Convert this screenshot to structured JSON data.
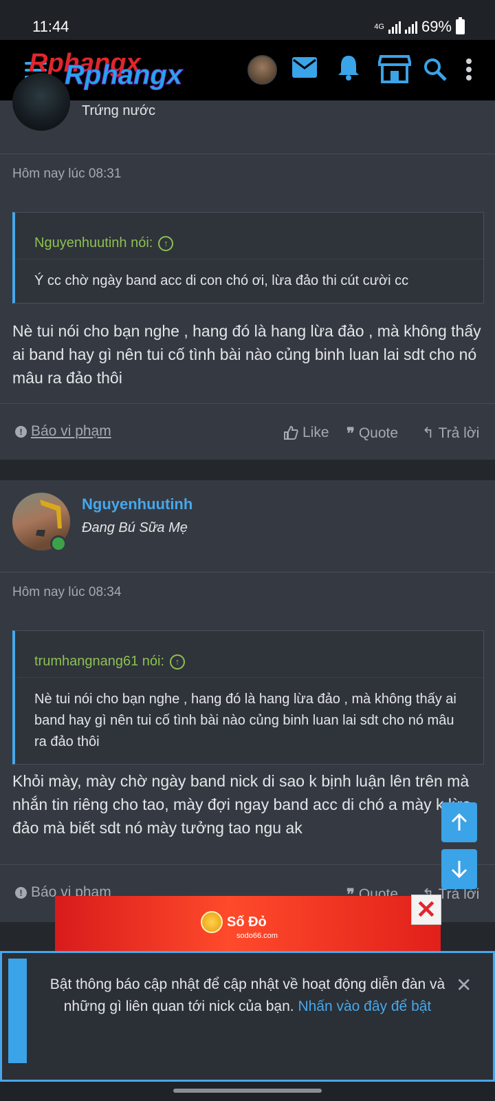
{
  "status": {
    "time": "11:44",
    "network": "4G",
    "battery": "69%"
  },
  "header": {
    "logo_text": "Rphangx"
  },
  "post1": {
    "user_title": "Trứng nước",
    "date": "Hôm nay lúc 08:31",
    "quote_author": "Nguyenhuutinh nói:",
    "quote_text": "Ý cc chờ ngày band acc di con chó ơi, lừa đảo thi cút cười cc",
    "text": "Nè tui nói cho bạn nghe , hang đó là hang lừa đảo , mà không thấy ai band hay gì nên tui cố tình bài nào củng binh luan lai sdt cho nó mâu ra đảo thôi",
    "report": "Báo vi phạm",
    "like": "Like",
    "quote": "Quote",
    "reply": "Trả lời"
  },
  "post2": {
    "username": "Nguyenhuutinh",
    "user_title": "Đang Bú Sữa Mẹ",
    "date": "Hôm nay lúc 08:34",
    "quote_author": "trumhangnang61 nói:",
    "quote_text": "Nè tui nói cho bạn nghe , hang đó là hang lừa đảo , mà không thấy ai band hay gì nên tui cố tình bài nào củng binh luan lai sdt cho nó mâu ra đảo thôi",
    "text": "Khỏi mày, mày chờ ngày band nick di sao k bịnh luận lên trên mà nhắn tin riêng cho tao, mày đợi ngay band acc di chó a mày k lừa đảo mà biết sdt nó mày tưởng tao ngu ak",
    "report": "Báo vi phạm",
    "quote": "Quote",
    "reply": "Trả lời"
  },
  "ad": {
    "brand": "Số Đỏ",
    "site": "sodo66.com"
  },
  "notice": {
    "text": "Bật thông báo cập nhật để cập nhật về hoạt động diễn đàn và những gì liên quan tới nick của bạn. ",
    "link": "Nhấn vào đây để bật"
  }
}
